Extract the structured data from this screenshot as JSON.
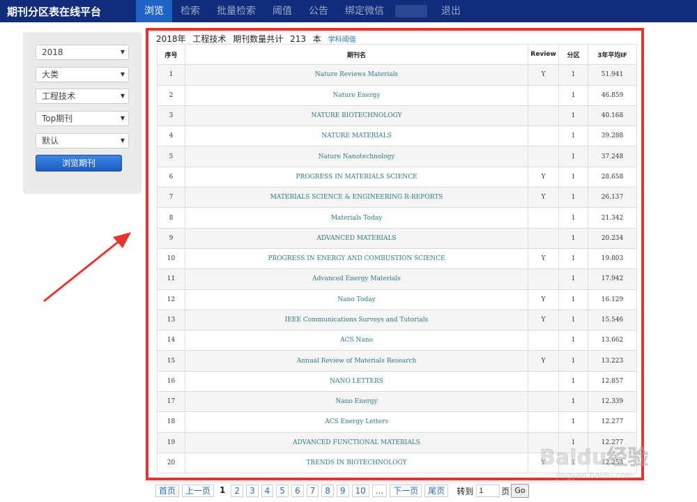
{
  "app": {
    "title": "期刊分区表在线平台"
  },
  "nav": {
    "items": [
      {
        "label": "浏览",
        "active": true
      },
      {
        "label": "检索",
        "active": false
      },
      {
        "label": "批量检索",
        "active": false
      },
      {
        "label": "阈值",
        "active": false
      },
      {
        "label": "公告",
        "active": false
      },
      {
        "label": "绑定微信",
        "active": false
      }
    ],
    "logout_label": "退出"
  },
  "filters": {
    "year": "2018",
    "level": "大类",
    "subject": "工程技术",
    "scope": "Top期刊",
    "sort": "默认",
    "browse_button": "浏览期刊"
  },
  "summary": {
    "year": "2018年",
    "subject": "工程技术",
    "count_text": "期刊数量共计",
    "count": "213",
    "unit": "本",
    "threshold_link": "学科阈值"
  },
  "table": {
    "headers": {
      "no": "序号",
      "name": "期刊名",
      "review": "Review",
      "zone": "分区",
      "if": "3年平均IF"
    },
    "rows": [
      {
        "no": "1",
        "name": "Nature Reviews Materials",
        "review": "Y",
        "zone": "1",
        "if": "51.941"
      },
      {
        "no": "2",
        "name": "Nature Energy",
        "review": "",
        "zone": "1",
        "if": "46.859"
      },
      {
        "no": "3",
        "name": "NATURE BIOTECHNOLOGY",
        "review": "",
        "zone": "1",
        "if": "40.168"
      },
      {
        "no": "4",
        "name": "NATURE MATERIALS",
        "review": "",
        "zone": "1",
        "if": "39.288"
      },
      {
        "no": "5",
        "name": "Nature Nanotechnology",
        "review": "",
        "zone": "1",
        "if": "37.248"
      },
      {
        "no": "6",
        "name": "PROGRESS IN MATERIALS SCIENCE",
        "review": "Y",
        "zone": "1",
        "if": "28.658"
      },
      {
        "no": "7",
        "name": "MATERIALS SCIENCE & ENGINEERING R-REPORTS",
        "review": "Y",
        "zone": "1",
        "if": "26.137"
      },
      {
        "no": "8",
        "name": "Materials Today",
        "review": "",
        "zone": "1",
        "if": "21.342"
      },
      {
        "no": "9",
        "name": "ADVANCED MATERIALS",
        "review": "",
        "zone": "1",
        "if": "20.234"
      },
      {
        "no": "10",
        "name": "PROGRESS IN ENERGY AND COMBUSTION SCIENCE",
        "review": "Y",
        "zone": "1",
        "if": "19.803"
      },
      {
        "no": "11",
        "name": "Advanced Energy Materials",
        "review": "",
        "zone": "1",
        "if": "17.942"
      },
      {
        "no": "12",
        "name": "Nano Today",
        "review": "Y",
        "zone": "1",
        "if": "16.129"
      },
      {
        "no": "13",
        "name": "IEEE Communications Surveys and Tutorials",
        "review": "Y",
        "zone": "1",
        "if": "15.546"
      },
      {
        "no": "14",
        "name": "ACS Nano",
        "review": "",
        "zone": "1",
        "if": "13.662"
      },
      {
        "no": "15",
        "name": "Annual Review of Materials Research",
        "review": "Y",
        "zone": "1",
        "if": "13.223"
      },
      {
        "no": "16",
        "name": "NANO LETTERS",
        "review": "",
        "zone": "1",
        "if": "12.857"
      },
      {
        "no": "17",
        "name": "Nano Energy",
        "review": "",
        "zone": "1",
        "if": "12.339"
      },
      {
        "no": "18",
        "name": "ACS Energy Letters",
        "review": "",
        "zone": "1",
        "if": "12.277"
      },
      {
        "no": "19",
        "name": "ADVANCED FUNCTIONAL MATERIALS",
        "review": "",
        "zone": "1",
        "if": "12.277"
      },
      {
        "no": "20",
        "name": "TRENDS IN BIOTECHNOLOGY",
        "review": "Y",
        "zone": "1",
        "if": "12.253"
      }
    ]
  },
  "pagination": {
    "first": "首页",
    "prev": "上一页",
    "current": "1",
    "pages": [
      "2",
      "3",
      "4",
      "5",
      "6",
      "7",
      "8",
      "9",
      "10"
    ],
    "ellipsis": "...",
    "next": "下一页",
    "last": "尾页",
    "goto_label": "转到",
    "goto_value": "1",
    "goto_unit": "页",
    "go_button": "Go"
  },
  "watermark": {
    "text": "Baidu经验",
    "sub": "jingyan.baidu.com"
  },
  "colors": {
    "nav_bg": "#0f2d7a",
    "nav_active": "#1e63c6",
    "highlight_red": "#e8342c",
    "link": "#2c7a86"
  }
}
